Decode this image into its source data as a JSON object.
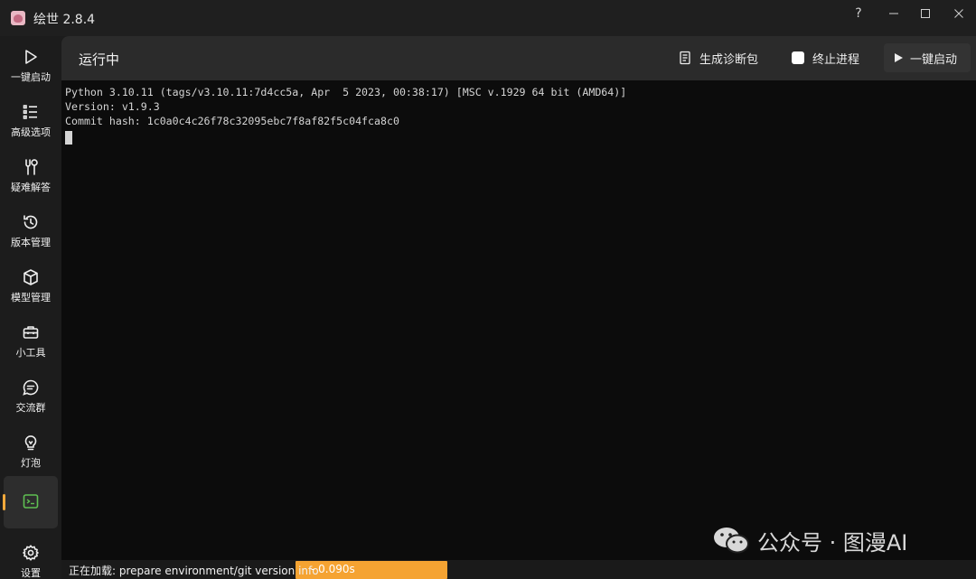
{
  "app": {
    "title": "绘世 2.8.4"
  },
  "window_controls": {
    "help": "?"
  },
  "sidebar": {
    "items": [
      {
        "label": "一键启动",
        "icon": "play-icon"
      },
      {
        "label": "高级选项",
        "icon": "list-icon"
      },
      {
        "label": "疑难解答",
        "icon": "tools-icon"
      },
      {
        "label": "版本管理",
        "icon": "history-icon"
      },
      {
        "label": "模型管理",
        "icon": "cube-icon"
      },
      {
        "label": "小工具",
        "icon": "toolbox-icon"
      },
      {
        "label": "交流群",
        "icon": "chat-icon"
      },
      {
        "label": "灯泡",
        "icon": "bulb-icon"
      },
      {
        "label": "",
        "icon": "console-icon",
        "active": true
      },
      {
        "label": "设置",
        "icon": "gear-icon"
      }
    ]
  },
  "header": {
    "title": "运行中",
    "diagnostic_label": "生成诊断包",
    "terminate_label": "终止进程",
    "launch_label": "一键启动"
  },
  "terminal": {
    "lines": [
      "Python 3.10.11 (tags/v3.10.11:7d4cc5a, Apr  5 2023, 00:38:17) [MSC v.1929 64 bit (AMD64)]",
      "Version: v1.9.3",
      "Commit hash: 1c0a0c4c26f78c32095ebc7f8af82f5c04fca8c0"
    ]
  },
  "watermark": {
    "text": "公众号 · 图漫AI"
  },
  "status": {
    "text": "正在加载: prepare environment/git version info",
    "elapsed": "- 0.090s"
  },
  "colors": {
    "accent": "#f2a93b",
    "progress": "#f5a332",
    "terminal_bg": "#0c0c0c",
    "active_console_icon": "#5fbf52"
  }
}
